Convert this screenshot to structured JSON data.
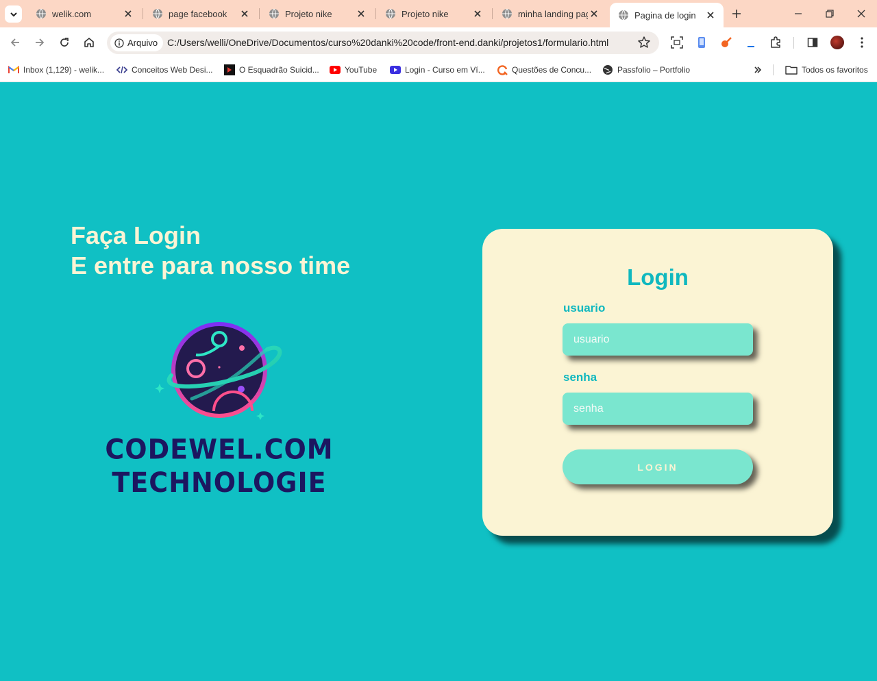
{
  "browser": {
    "tabs": [
      {
        "title": "welik.com"
      },
      {
        "title": "page facebook"
      },
      {
        "title": "Projeto nike"
      },
      {
        "title": "Projeto nike"
      },
      {
        "title": "minha landing page"
      },
      {
        "title": "Pagina de login",
        "active": true
      }
    ],
    "address": {
      "chip_label": "Arquivo",
      "url": "C:/Users/welli/OneDrive/Documentos/curso%20danki%20code/front-end.danki/projetos1/formulario.html"
    },
    "bookmarks": [
      {
        "label": "Inbox (1,129) - welik...",
        "icon": "gmail-icon"
      },
      {
        "label": "Conceitos Web Desi...",
        "icon": "code-icon"
      },
      {
        "label": "O Esquadrão Suicid...",
        "icon": "movie-icon"
      },
      {
        "label": "YouTube",
        "icon": "youtube-icon"
      },
      {
        "label": "Login - Curso em Ví...",
        "icon": "video-icon"
      },
      {
        "label": "Questões de Concu...",
        "icon": "qconcursos-icon"
      },
      {
        "label": "Passfolio – Portfolio",
        "icon": "globe-icon"
      }
    ],
    "all_bookmarks_label": "Todos os favoritos"
  },
  "page": {
    "hero": {
      "line1": "Faça Login",
      "line2": "E entre para nosso time"
    },
    "brand": {
      "line1": "CODEWEL.COM",
      "line2": "TECHNOLOGIE"
    },
    "login_card": {
      "title": "Login",
      "user_label": "usuario",
      "user_placeholder": "usuario",
      "pass_label": "senha",
      "pass_placeholder": "senha",
      "button_label": "LOGIN"
    }
  },
  "colors": {
    "background": "#10c0c4",
    "card": "#fbf4d4",
    "accent": "#10b8bf",
    "field": "#7ae6cf",
    "brand_text": "#1c1660",
    "tabstrip": "#fcd7c5"
  }
}
